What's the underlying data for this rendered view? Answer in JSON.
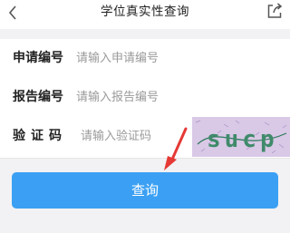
{
  "header": {
    "title": "学位真实性查询"
  },
  "form": {
    "application_number": {
      "label": "申请编号",
      "placeholder": "请输入申请编号"
    },
    "report_number": {
      "label": "报告编号",
      "placeholder": "请输入报告编号"
    },
    "captcha": {
      "label": "验证码",
      "placeholder": "请输入验证码",
      "image_text": "sucp"
    }
  },
  "actions": {
    "query_label": "查询"
  },
  "colors": {
    "primary_button": "#3ba0f3",
    "annotation_arrow": "#e53935",
    "captcha_background": "#d9c8e6"
  }
}
